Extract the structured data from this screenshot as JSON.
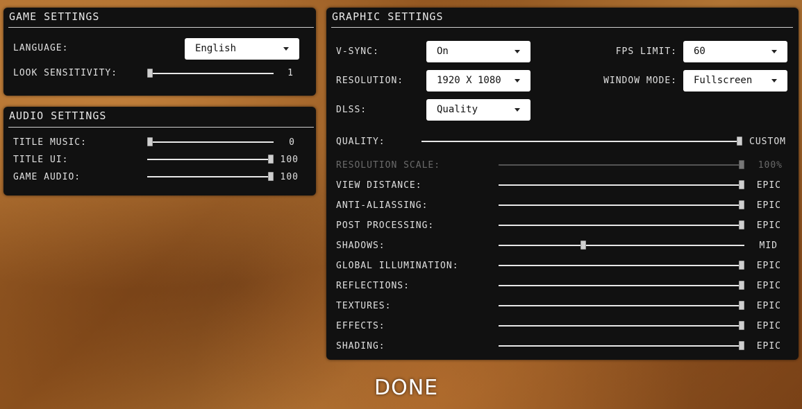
{
  "game_settings": {
    "title": "GAME SETTINGS",
    "language": {
      "label": "LANGUAGE:",
      "value": "English"
    },
    "look_sensitivity": {
      "label": "LOOK SENSITIVITY:",
      "value": "1",
      "level": 0.0
    }
  },
  "audio_settings": {
    "title": "AUDIO SETTINGS",
    "sliders": [
      {
        "label": "TITLE MUSIC:",
        "value": "0",
        "level": 0.0
      },
      {
        "label": "TITLE UI:",
        "value": "100",
        "level": 1.0
      },
      {
        "label": "GAME AUDIO:",
        "value": "100",
        "level": 1.0
      }
    ]
  },
  "graphic_settings": {
    "title": "GRAPHIC SETTINGS",
    "vsync": {
      "label": "V-SYNC:",
      "value": "On"
    },
    "resolution": {
      "label": "RESOLUTION:",
      "value": "1920 X 1080"
    },
    "dlss": {
      "label": "DLSS:",
      "value": "Quality"
    },
    "fps_limit": {
      "label": "FPS LIMIT:",
      "value": "60"
    },
    "window_mode": {
      "label": "WINDOW MODE:",
      "value": "Fullscreen"
    },
    "quality": {
      "label": "QUALITY:",
      "value": "CUSTOM",
      "level": 1.0
    },
    "resolution_scale": {
      "label": "RESOLUTION SCALE:",
      "value": "100%",
      "level": 1.0,
      "disabled": true
    },
    "sliders": [
      {
        "label": "VIEW DISTANCE:",
        "value": "EPIC",
        "level": 1.0
      },
      {
        "label": "ANTI-ALIASSING:",
        "value": "EPIC",
        "level": 1.0
      },
      {
        "label": "POST PROCESSING:",
        "value": "EPIC",
        "level": 1.0
      },
      {
        "label": "SHADOWS:",
        "value": "MID",
        "level": 0.34
      },
      {
        "label": "GLOBAL ILLUMINATION:",
        "value": "EPIC",
        "level": 1.0
      },
      {
        "label": "REFLECTIONS:",
        "value": "EPIC",
        "level": 1.0
      },
      {
        "label": "TEXTURES:",
        "value": "EPIC",
        "level": 1.0
      },
      {
        "label": "EFFECTS:",
        "value": "EPIC",
        "level": 1.0
      },
      {
        "label": "SHADING:",
        "value": "EPIC",
        "level": 1.0
      }
    ]
  },
  "done_label": "DONE"
}
